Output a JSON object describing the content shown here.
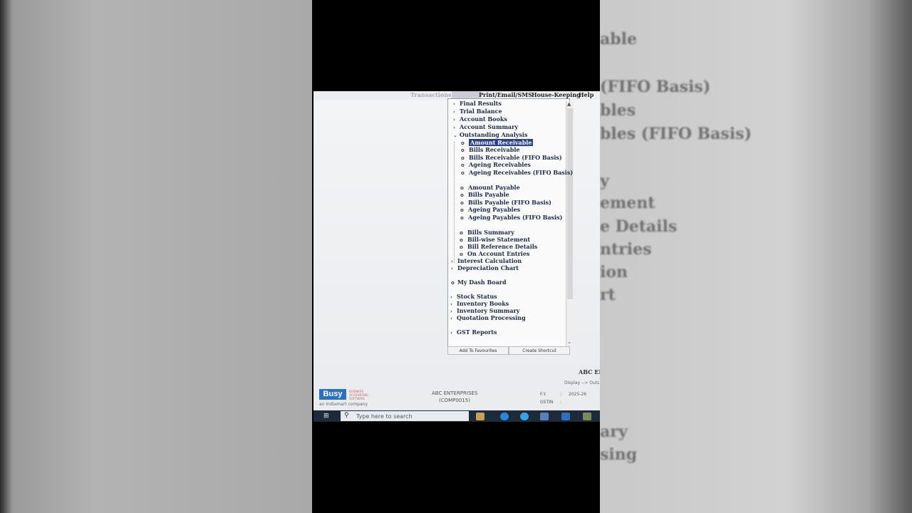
{
  "background_text": [
    "able",
    "(FIFO Basis)",
    "bles",
    "bles (FIFO Basis)",
    "y",
    "ement",
    "e Details",
    "ntries",
    "ion",
    "rt",
    "ary",
    "sing"
  ],
  "menubar": {
    "items": [
      "Transactions",
      "Reports",
      "Print/Email/SMS",
      "House-Keeping",
      "Help"
    ]
  },
  "tree": {
    "top": [
      {
        "label": "Final Results",
        "marker": "›"
      },
      {
        "label": "Trial Balance",
        "marker": "›"
      },
      {
        "label": "Account Books",
        "marker": "›"
      },
      {
        "label": "Account Summary",
        "marker": "›"
      },
      {
        "label": "Outstanding Analysis",
        "marker": "⌄"
      }
    ],
    "receivables": [
      "Amount Receivable",
      "Bills Receivable",
      "Bills Receivable (FIFO Basis)",
      "Ageing Receivables",
      "Ageing Receivables (FIFO Basis)"
    ],
    "payables": [
      "Amount Payable",
      "Bills Payable",
      "Bills Payable (FIFO Basis)",
      "Ageing Payables",
      "Ageing Payables (FIFO Basis)"
    ],
    "bills": [
      "Bills Summary",
      "Bill-wise Statement",
      "Bill Reference Details",
      "On Account Entries"
    ],
    "mid": [
      "Interest Calculation",
      "Depreciation Chart"
    ],
    "dashboard": "My Dash Board",
    "inventory": [
      "Stock Status",
      "Inventory Books",
      "Inventory Summary",
      "Quotation Processing"
    ],
    "gst": "GST Reports",
    "selected": "Amount Receivable"
  },
  "footer": {
    "add_favourites": "Add To Favourites",
    "create_shortcut": "Create Shortcut"
  },
  "status": {
    "company_right": "ABC EN",
    "display_path": "Display --> Outs",
    "logo": "Busy",
    "logo_sub": "BUSINESS ACCOUNTING SOFTWARE",
    "logo_tag": "an Indiamart company",
    "company_name": "ABC ENTERPRISES",
    "company_code": "(COMP0015)",
    "fy_label": "F.Y.",
    "fy_sep": ":",
    "fy_value": "2025-26",
    "gstin_label": "GSTIN",
    "gstin_sep": ":"
  },
  "taskbar": {
    "search_placeholder": "Type here to search"
  },
  "colors": {
    "selection": "#2c3e8f",
    "logo_blue": "#2f6fc2",
    "taskbar": "#1d2a3a"
  }
}
